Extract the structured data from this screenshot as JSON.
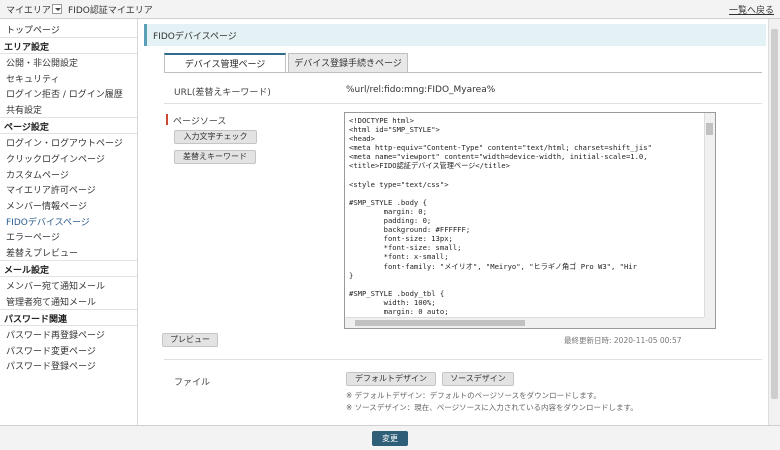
{
  "topbar": {
    "crumb": "マイエリア",
    "title": "FIDO認証マイエリア",
    "back_link": "一覧へ戻る"
  },
  "sidebar": {
    "top": "トップページ",
    "sections": [
      {
        "heading": "エリア設定",
        "items": [
          "公開・非公開設定",
          "セキュリティ",
          "ログイン拒否 / ログイン履歴",
          "共有設定"
        ]
      },
      {
        "heading": "ページ設定",
        "items": [
          "ログイン・ログアウトページ",
          "クリックログインページ",
          "カスタムページ",
          "マイエリア許可ページ",
          "メンバー情報ページ",
          "FIDOデバイスページ",
          "エラーページ",
          "差替えプレビュー"
        ]
      },
      {
        "heading": "メール設定",
        "items": [
          "メンバー宛て通知メール",
          "管理者宛て通知メール"
        ]
      },
      {
        "heading": "パスワード関連",
        "items": [
          "パスワード再登録ページ",
          "パスワード変更ページ",
          "パスワード登録ページ"
        ]
      }
    ]
  },
  "page_title": "FIDOデバイスページ",
  "tabs": [
    "デバイス管理ページ",
    "デバイス登録手続きページ"
  ],
  "form": {
    "url_label": "URL(差替えキーワード)",
    "url_value": "%url/rel:fido:mng:FIDO_Myarea%",
    "source_label": "ページソース",
    "check_button": "入力文字チェック",
    "keyword_button": "差替えキーワード",
    "source_code": "<!DOCTYPE html>\n<html id=\"SMP_STYLE\">\n<head>\n<meta http-equiv=\"Content-Type\" content=\"text/html; charset=shift_jis\"\n<meta name=\"viewport\" content=\"width=device-width, initial-scale=1.0,\n<title>FIDO認証デバイス管理ページ</title>\n\n<style type=\"text/css\">\n\n#SMP_STYLE .body {\n        margin: 0;\n        padding: 0;\n        background: #FFFFFF;\n        font-size: 13px;\n        *font-size: small;\n        *font: x-small;\n        font-family: \"メイリオ\", \"Meiryo\", \"ヒラギノ角ゴ Pro W3\", \"Hir\n}\n\n#SMP_STYLE .body_tbl {\n        width: 100%;\n        margin: 0 auto;",
    "preview_button": "プレビュー",
    "last_updated": "最終更新日時: 2020-11-05 00:57",
    "file_label": "ファイル",
    "default_design_button": "デフォルトデザイン",
    "source_design_button": "ソースデザイン",
    "note_1": "※ デフォルトデザイン：デフォルトのページソースをダウンロードします。",
    "note_2": "※ ソースデザイン：現在、ページソースに入力されている内容をダウンロードします。"
  },
  "footer": {
    "submit": "変更"
  }
}
